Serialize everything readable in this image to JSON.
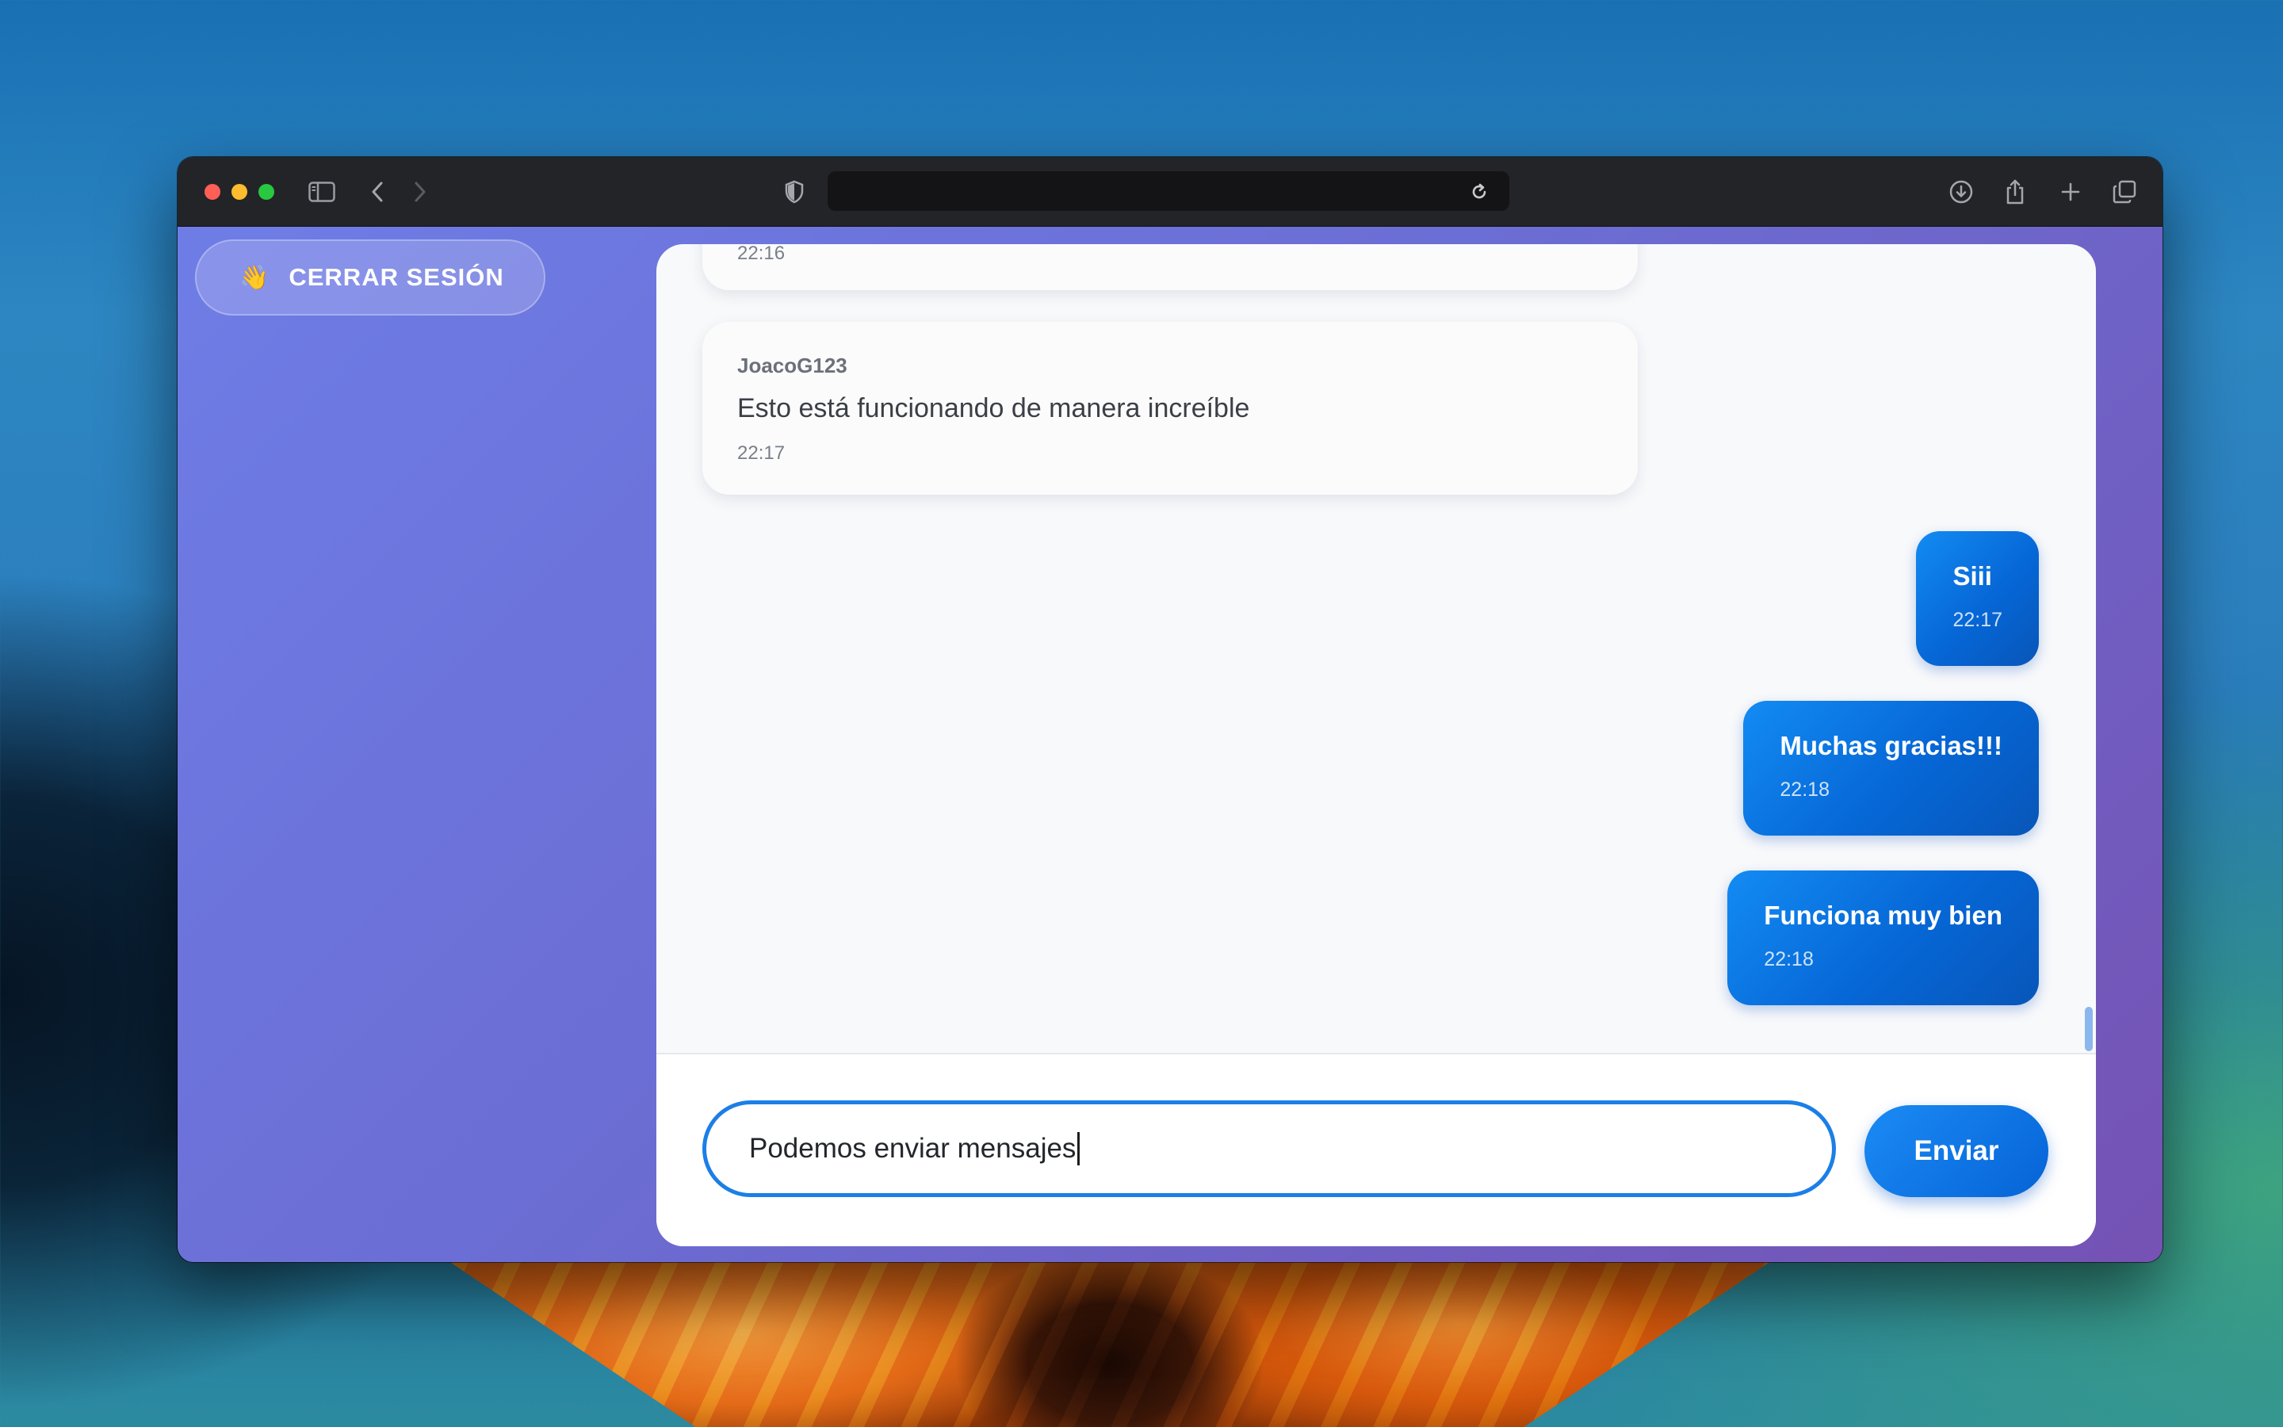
{
  "browser": {
    "url": ""
  },
  "sidebar": {
    "logout_icon": "waving-hand-icon",
    "logout_emoji": "👋",
    "logout_label": "CERRAR SESIÓN"
  },
  "chat": {
    "messages": [
      {
        "direction": "incoming",
        "user": "",
        "text": "",
        "time": "22:16"
      },
      {
        "direction": "incoming",
        "user": "JoacoG123",
        "text": "Esto está funcionando de manera increíble",
        "time": "22:17"
      },
      {
        "direction": "outgoing",
        "text": "Siii",
        "time": "22:17"
      },
      {
        "direction": "outgoing",
        "text": "Muchas gracias!!!",
        "time": "22:18"
      },
      {
        "direction": "outgoing",
        "text": "Funciona muy bien",
        "time": "22:18"
      }
    ],
    "composer": {
      "value": "Podemos enviar mensajes",
      "send_label": "Enviar"
    }
  },
  "colors": {
    "accent": "#0a6fe0",
    "page_gradient_start": "#6e7de6",
    "page_gradient_end": "#7552b4"
  }
}
